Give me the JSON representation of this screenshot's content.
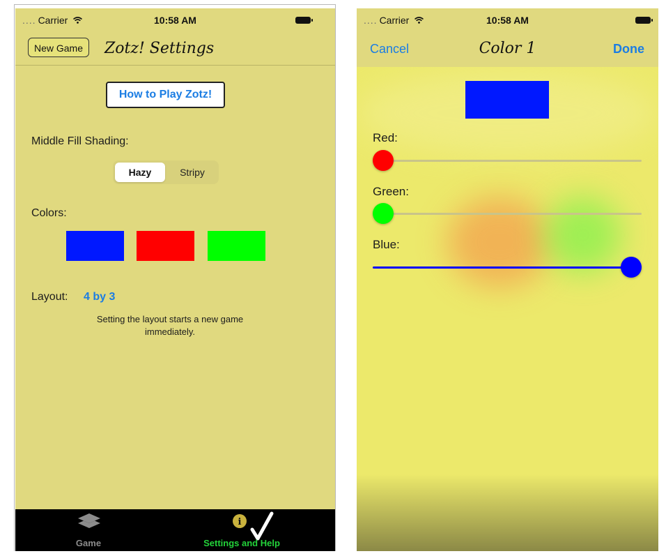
{
  "status_bar": {
    "dots": "....",
    "carrier": "Carrier",
    "time": "10:58 AM"
  },
  "settings_screen": {
    "new_game_label": "New Game",
    "title": "Zotz! Settings",
    "how_to_play_label": "How to Play Zotz!",
    "shading_label": "Middle Fill Shading:",
    "shading_options": [
      "Hazy",
      "Stripy"
    ],
    "shading_selected": "Hazy",
    "colors_label": "Colors:",
    "colors": [
      "#0018ff",
      "#ff0000",
      "#00ff00"
    ],
    "layout_label": "Layout:",
    "layout_value": "4 by 3",
    "layout_note": "Setting the layout starts a new game immediately."
  },
  "tab_bar": {
    "tabs": [
      {
        "label": "Game",
        "icon": "stacked-layers-icon",
        "selected": false
      },
      {
        "label": "Settings and Help",
        "icon": "info-checkmark-icon",
        "selected": true
      }
    ]
  },
  "color_picker": {
    "cancel_label": "Cancel",
    "title": "Color 1",
    "done_label": "Done",
    "preview_color": "#0018ff",
    "sliders": [
      {
        "label": "Red:",
        "value": 0.0,
        "color": "#ff0000"
      },
      {
        "label": "Green:",
        "value": 0.0,
        "color": "#00ff00"
      },
      {
        "label": "Blue:",
        "value": 1.0,
        "color": "#0000ff"
      }
    ]
  },
  "colors": {
    "accent": "#1b7de3",
    "background_left": "#e0d97f",
    "background_right": "#ece96b",
    "tab_selected": "#23d33a"
  }
}
